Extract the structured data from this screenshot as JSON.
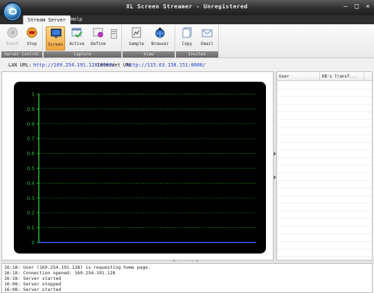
{
  "window": {
    "title": "XL Screen Streamer - Unregistered"
  },
  "tabs": [
    {
      "label": "Stream Server",
      "active": true
    },
    {
      "label": "Help",
      "active": false
    }
  ],
  "ribbon": {
    "groups": [
      {
        "label": "Server Control",
        "buttons": [
          {
            "label": "Start",
            "icon": "start-icon",
            "enabled": false
          },
          {
            "label": "Stop",
            "icon": "stop-icon",
            "enabled": true
          }
        ]
      },
      {
        "label": "Capture",
        "buttons": [
          {
            "label": "Screen",
            "icon": "monitor-icon",
            "active": true
          },
          {
            "label": "Active",
            "icon": "active-window-icon"
          },
          {
            "label": "Define",
            "icon": "define-region-icon"
          }
        ]
      },
      {
        "label": "View",
        "buttons": [
          {
            "label": "Sample",
            "icon": "sample-icon"
          },
          {
            "label": "Browser",
            "icon": "browser-icon"
          }
        ]
      },
      {
        "label": "Invites",
        "buttons": [
          {
            "label": "Copy",
            "icon": "copy-icon"
          },
          {
            "label": "Email",
            "icon": "email-icon"
          }
        ]
      }
    ]
  },
  "urls": {
    "lan_label": "LAN URL:",
    "lan_url": "http://169.254.191.128:8080/",
    "internet_label": "Internet URL",
    "internet_url": "http://115.63.158.151:8080/"
  },
  "chart_data": {
    "type": "line",
    "ylim": [
      0,
      1
    ],
    "yticks": [
      "0",
      "0.1",
      "0.2",
      "0.3",
      "0.4",
      "0.5",
      "0.6",
      "0.7",
      "0.8",
      "0.9",
      "1"
    ],
    "grid": true,
    "series": [
      {
        "values": [
          0,
          0
        ],
        "color": "#3a5bff"
      }
    ],
    "colors": {
      "background": "#000000",
      "grid": "#1fae2f",
      "axis": "#27c03a",
      "line": "#3a5bff"
    }
  },
  "clients": {
    "columns": [
      "User",
      "KB's Transf..."
    ],
    "rows": []
  },
  "log": [
    "16:18: User (169.254.191.128) is requesting home page.",
    "16:18: Connection opened: 169.254.191.128",
    "16:18: Server started",
    "16:08: Server stopped",
    "16:08: Server started"
  ],
  "splitter_handle": "▾ ········ ▾"
}
